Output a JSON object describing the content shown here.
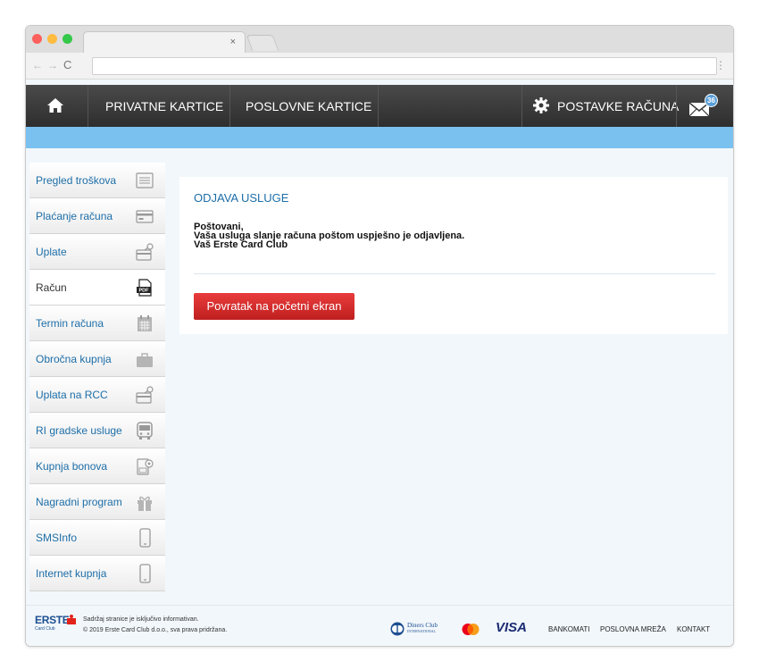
{
  "browser": {
    "tab_close": "×",
    "back": "←",
    "forward": "→",
    "reload": "C",
    "menu": "⋮",
    "url": ""
  },
  "header": {
    "nav": {
      "private_cards": "PRIVATNE KARTICE",
      "business_cards": "POSLOVNE KARTICE",
      "account_settings": "POSTAVKE RAČUNA"
    },
    "mail_badge": "36",
    "colors": {
      "nav_bg": "#3a3a3a",
      "info_bar": "#7ac1f0"
    }
  },
  "sidebar": {
    "items": [
      {
        "label": "Pregled troškova",
        "icon": "list-icon"
      },
      {
        "label": "Plaćanje računa",
        "icon": "card-icon"
      },
      {
        "label": "Uplate",
        "icon": "deposit-icon"
      },
      {
        "label": "Račun",
        "icon": "pdf-icon",
        "active": true
      },
      {
        "label": "Termin računa",
        "icon": "calendar-icon"
      },
      {
        "label": "Obročna kupnja",
        "icon": "bag-icon"
      },
      {
        "label": "Uplata na RCC",
        "icon": "deposit-icon"
      },
      {
        "label": "RI gradske usluge",
        "icon": "bus-icon"
      },
      {
        "label": "Kupnja bonova",
        "icon": "voucher-icon"
      },
      {
        "label": "Nagradni program",
        "icon": "gift-icon"
      },
      {
        "label": "SMSInfo",
        "icon": "phone-icon"
      },
      {
        "label": "Internet kupnja",
        "icon": "phone-icon"
      }
    ]
  },
  "main": {
    "title": "ODJAVA USLUGE",
    "message": [
      "Poštovani,",
      "Vaša usluga slanje računa poštom uspješno je odjavljena.",
      "Vaš Erste Card Club"
    ],
    "back_button": "Povratak na početni ekran",
    "colors": {
      "title": "#1d6ea8",
      "button": "#d32f2f"
    }
  },
  "footer": {
    "logo_word": "ERSTE",
    "logo_sub": "Card Club",
    "disclaimer": "Sadržaj stranice je isključivo informativan.",
    "copyright": "© 2019 Erste Card Club d.o.o., sva prava pridržana.",
    "diners_name": "Diners Club",
    "diners_sub": "INTERNATIONAL",
    "visa": "VISA",
    "links": [
      "BANKOMATI",
      "POSLOVNA MREŽA",
      "KONTAKT"
    ]
  }
}
